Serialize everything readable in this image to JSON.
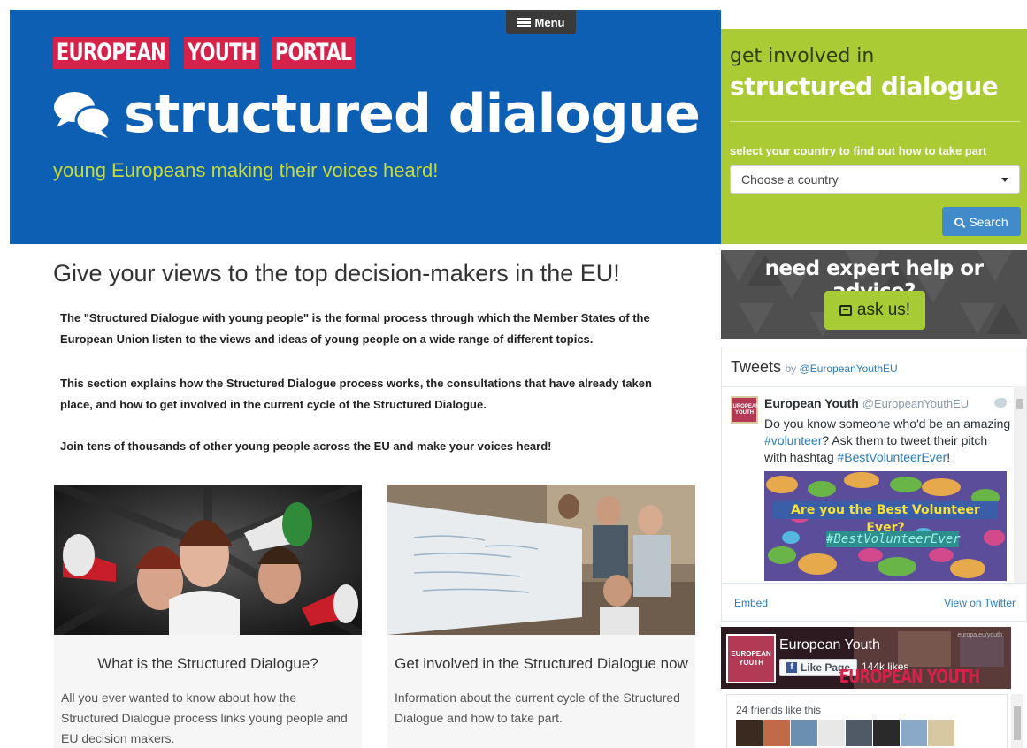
{
  "menu": {
    "label": "Menu"
  },
  "portal": {
    "words": [
      "EUROPEAN",
      "YOUTH",
      "PORTAL"
    ]
  },
  "header": {
    "title": "structured dialogue",
    "tagline": "young Europeans making their voices heard!"
  },
  "involve": {
    "line1": "get involved in",
    "line2": "structured dialogue",
    "prompt": "select your country to find out how to take part",
    "select_value": "Choose a country",
    "search_label": "Search"
  },
  "main": {
    "heading": "Give your views to the top decision-makers in the EU!",
    "paragraphs": [
      "The \"Structured Dialogue with young people\" is the formal process through which the Member States of the European Union listen to the views and ideas of young people on a wide range of different topics.",
      "This section explains how the Structured Dialogue process works, the consultations that have already taken place, and how to get involved in the current cycle of the Structured Dialogue.",
      "Join tens of thousands of other young people across the EU and make your voices heard!"
    ],
    "cards": [
      {
        "title": "What is the Structured Dialogue?",
        "text": "All you ever wanted to know about how the Structured Dialogue process links young people and EU decision makers."
      },
      {
        "title": "Get involved in the Structured Dialogue now",
        "text": "Information about the current cycle of the Structured Dialogue and how to take part."
      }
    ]
  },
  "expert": {
    "title": "need expert help or advice?",
    "button": "ask us!"
  },
  "tweets": {
    "heading": "Tweets",
    "by": "by",
    "by_handle": "@EuropeanYouthEU",
    "avatar_text": "EUROPEAN YOUTH",
    "author": "European Youth",
    "handle": "@EuropeanYouthEU",
    "text_1": "Do you know someone who'd be an amazing ",
    "tag_1": "#volunteer",
    "text_2": "? Ask them to tweet their pitch with hashtag ",
    "tag_2": "#BestVolunteerEver",
    "text_3": "!",
    "image_banner": "Are you the Best Volunteer Ever?",
    "image_hashtag": "#BestVolunteerEver",
    "embed": "Embed",
    "view": "View on Twitter"
  },
  "facebook": {
    "thumb_text": "EUROPEAN YOUTH",
    "page_name": "European Youth",
    "like_label": "Like Page",
    "likes": "144k likes",
    "brand": "EUROPEAN YOUTH",
    "url": "europa.eu/youth",
    "friends": "24 friends like this"
  },
  "colors": {
    "header_blue": "#0d5fb3",
    "lime": "#aacb33",
    "tagline": "#c6da3a",
    "portal_red": "#d6224b"
  }
}
